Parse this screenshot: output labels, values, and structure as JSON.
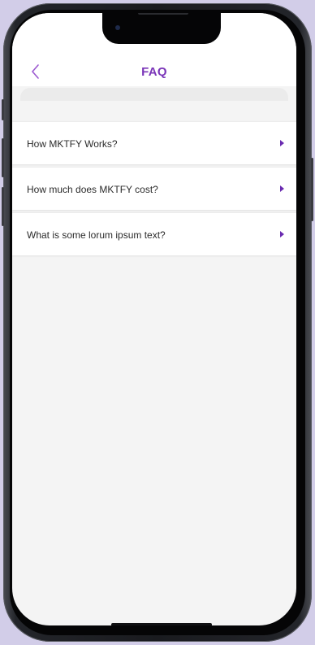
{
  "header": {
    "title": "FAQ",
    "back_icon": "chevron-left-icon",
    "accent_color": "#7a35b8"
  },
  "faq": {
    "items": [
      {
        "question": "How MKTFY Works?",
        "icon": "caret-right-icon"
      },
      {
        "question": "How much does MKTFY cost?",
        "icon": "caret-right-icon"
      },
      {
        "question": "What is some lorum ipsum text?",
        "icon": "caret-right-icon"
      }
    ]
  }
}
